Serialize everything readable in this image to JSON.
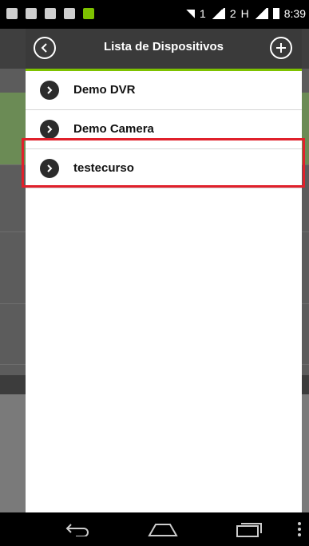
{
  "status_bar": {
    "signal_1": "1",
    "signal_2": "2",
    "network": "H",
    "time": "8:39"
  },
  "dialog": {
    "title": "Lista de Dispositivos",
    "back_icon": "chevron-left-circle-icon",
    "add_icon": "plus-circle-icon",
    "accent_color": "#7ec200",
    "devices": [
      {
        "label": "Demo DVR"
      },
      {
        "label": "Demo Camera"
      },
      {
        "label": "testecurso"
      }
    ],
    "highlight_color": "#e0202b"
  },
  "nav_bar": {
    "back_icon": "back-arrow-icon",
    "home_icon": "home-icon",
    "recent_icon": "recent-apps-icon",
    "menu_icon": "overflow-menu-icon"
  }
}
